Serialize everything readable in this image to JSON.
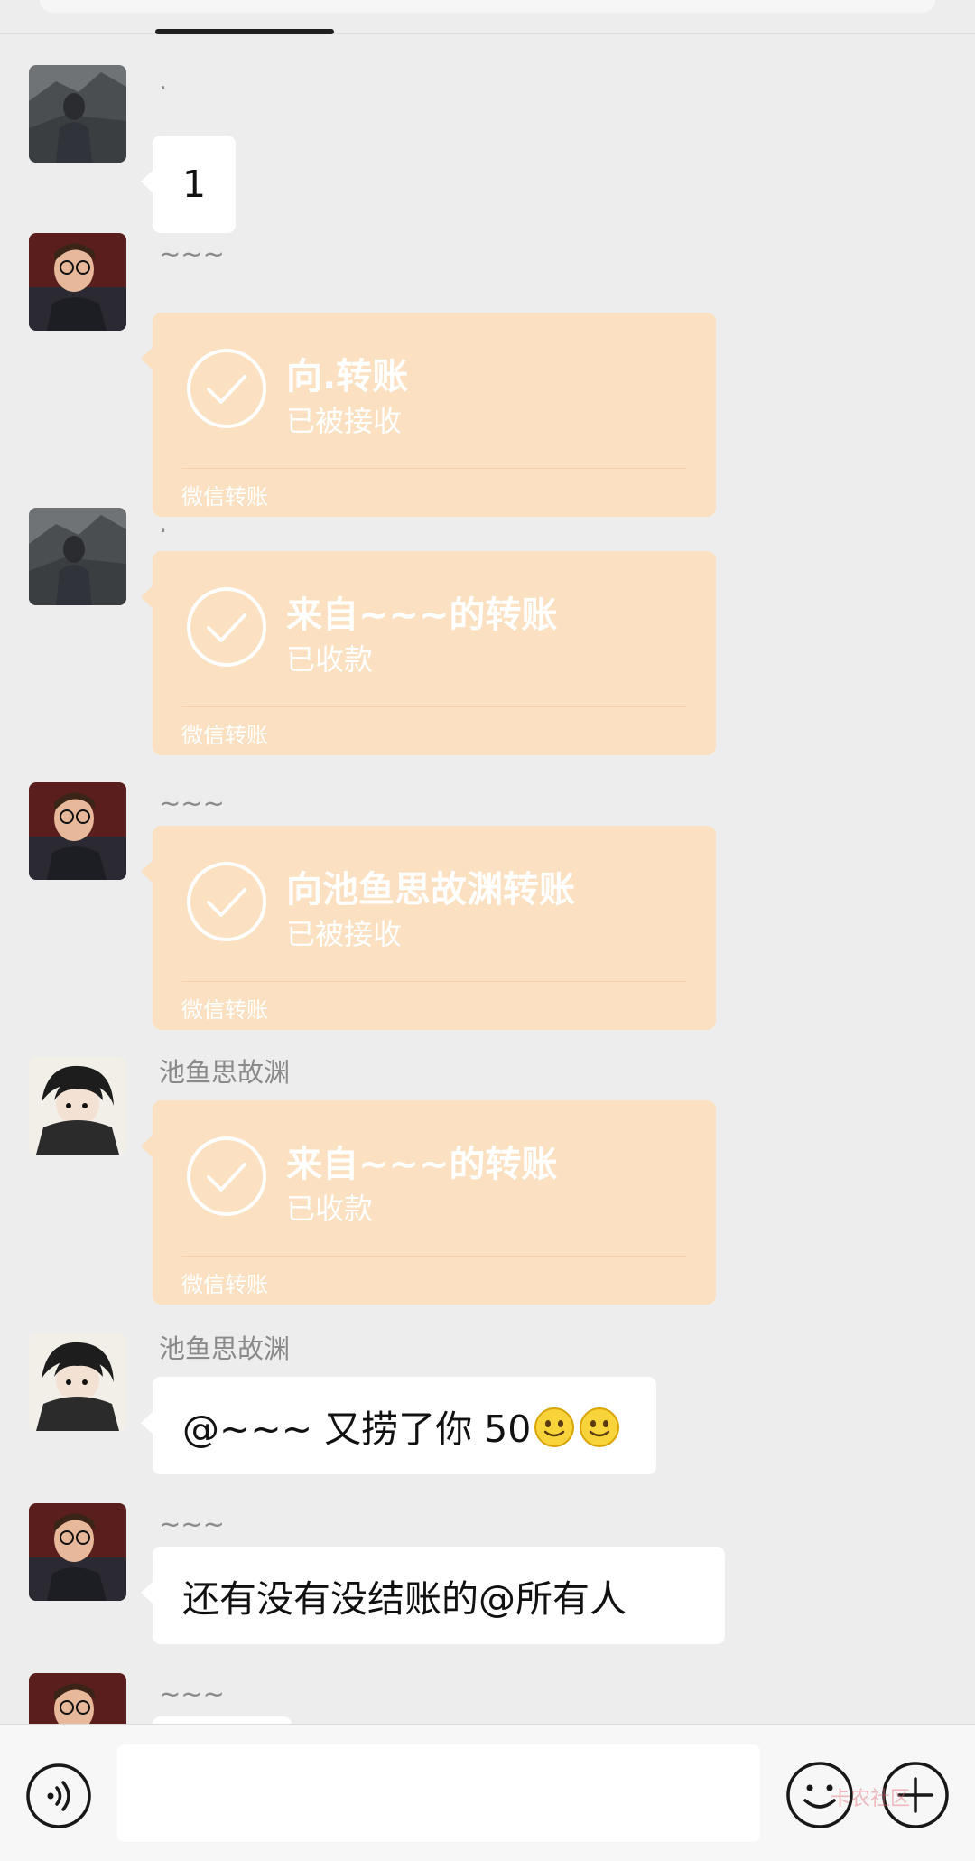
{
  "colors": {
    "background": "#ededed",
    "bubble": "#ffffff",
    "transfer_card": "#fbe0c1",
    "sender_text": "#8a8a8a"
  },
  "messages": [
    {
      "sender": ".",
      "type": "text",
      "text": "1"
    },
    {
      "sender": "~~~",
      "type": "transfer",
      "title": "向.转账",
      "status": "已被接收",
      "footer": "微信转账"
    },
    {
      "sender": ".",
      "type": "transfer",
      "title": "来自~~~的转账",
      "status": "已收款",
      "footer": "微信转账"
    },
    {
      "sender": "~~~",
      "type": "transfer",
      "title": "向池鱼思故渊转账",
      "status": "已被接收",
      "footer": "微信转账"
    },
    {
      "sender": "池鱼思故渊",
      "type": "transfer",
      "title": "来自~~~的转账",
      "status": "已收款",
      "footer": "微信转账"
    },
    {
      "sender": "池鱼思故渊",
      "type": "text",
      "text": "@~~~  又捞了你 50",
      "emoji": [
        "smile-emoji",
        "smile-emoji"
      ]
    },
    {
      "sender": "~~~",
      "type": "text",
      "text": "还有没有没结账的@所有人"
    },
    {
      "sender": "~~~",
      "type": "text",
      "text": ""
    }
  ],
  "input_bar": {
    "input_value": "",
    "icons": [
      "voice-icon",
      "emoji-icon",
      "plus-icon"
    ],
    "watermark": "卡农社区"
  }
}
